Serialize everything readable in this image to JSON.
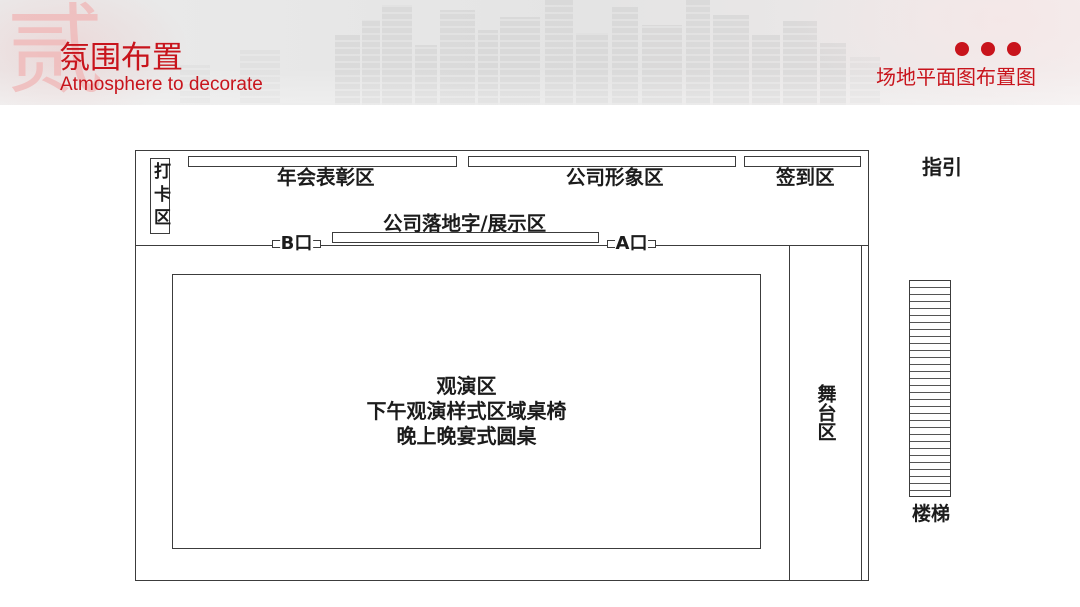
{
  "colors": {
    "accent": "#c8141c",
    "numeral": "#f0b9b9",
    "plan_line": "#3c3c3c",
    "plan_text": "#1c1c1c"
  },
  "header": {
    "section_numeral": "贰",
    "title": "氛围布置",
    "subtitle": "Atmosphere to decorate",
    "dots_icon": "three-dots-icon",
    "caption": "场地平面图布置图"
  },
  "floor_plan": {
    "checkin_area": "打卡区",
    "award_area": "年会表彰区",
    "company_image_area": "公司形象区",
    "sign_in_area": "签到区",
    "logo_display_area": "公司落地字/展示区",
    "entrance_b": "B口",
    "entrance_a": "A口",
    "audience_area": {
      "name": "观演区",
      "afternoon_setup": "下午观演样式区域桌椅",
      "evening_setup": "晚上晚宴式圆桌"
    },
    "stage_area": "舞台区",
    "guide": "指引",
    "stairs": "楼梯",
    "stairs_icon": "stairs-icon"
  }
}
